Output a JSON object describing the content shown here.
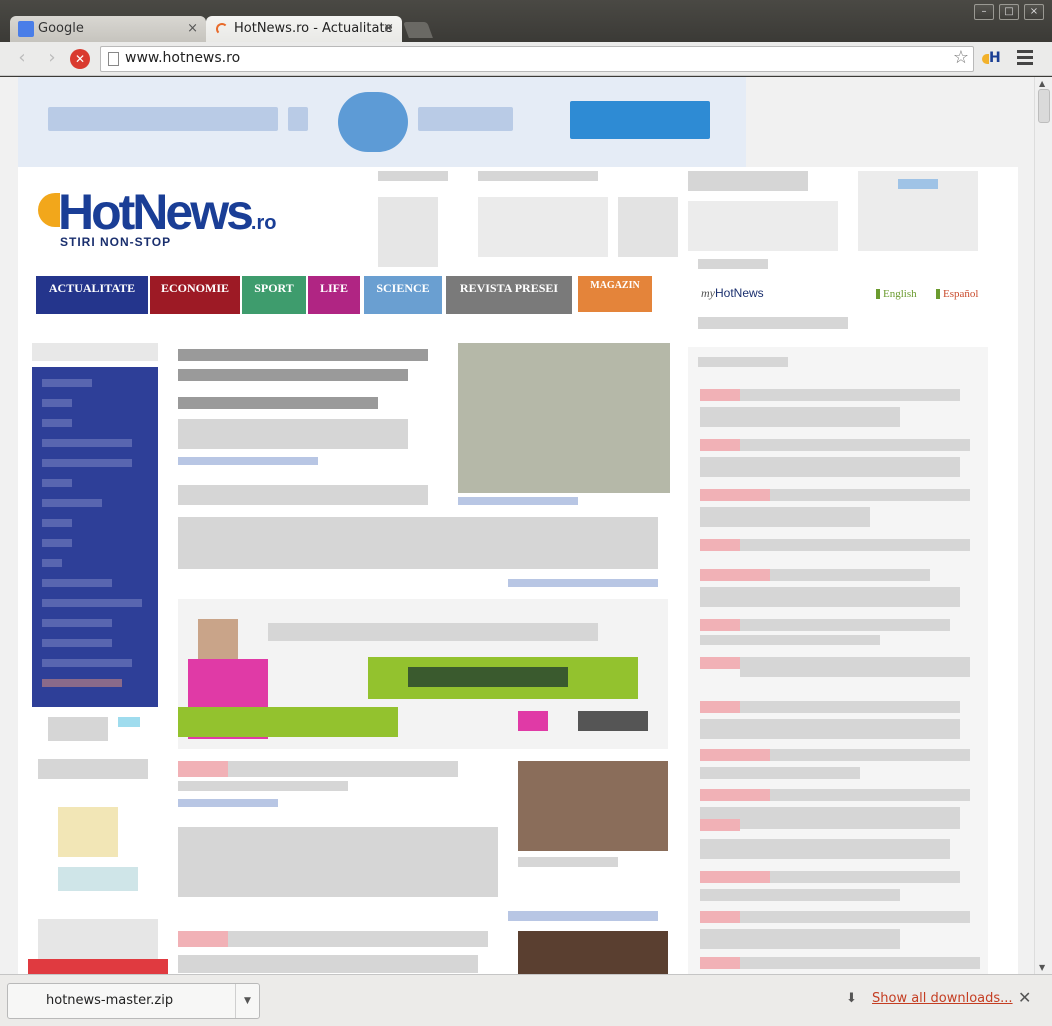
{
  "browser": {
    "tabs": [
      {
        "title": "Google",
        "favicon": "google-g-icon",
        "active": false
      },
      {
        "title": "HotNews.ro - Actualitate",
        "favicon": "loading-spinner-icon",
        "active": true
      }
    ],
    "url": "www.hotnews.ro",
    "tab_close_glyph": "×",
    "window_buttons": {
      "minimize": "–",
      "maximize": "□",
      "close": "×"
    }
  },
  "site": {
    "logo": {
      "name": "HotNews",
      "suffix": ".ro",
      "tagline": "STIRI NON-STOP"
    },
    "nav": [
      {
        "label": "ACTUALITATE",
        "color": "#24358c"
      },
      {
        "label": "ECONOMIE",
        "color": "#9d1a25"
      },
      {
        "label": "SPORT",
        "color": "#3e9c6d"
      },
      {
        "label": "LIFE",
        "color": "#b02583"
      },
      {
        "label": "SCIENCE",
        "color": "#6a9fd1"
      },
      {
        "label": "REVISTA PRESEI",
        "color": "#7a7a7a"
      },
      {
        "label": "MAGAZIN",
        "color": "#e4843a"
      }
    ],
    "myhotnews": {
      "prefix": "my",
      "name": "HotNews"
    },
    "languages": [
      {
        "label": "English",
        "color": "#6b9b2f"
      },
      {
        "label": "Español",
        "color": "#c94a2b"
      }
    ]
  },
  "download_bar": {
    "file": "hotnews-master.zip",
    "show_all": "Show all downloads..."
  }
}
